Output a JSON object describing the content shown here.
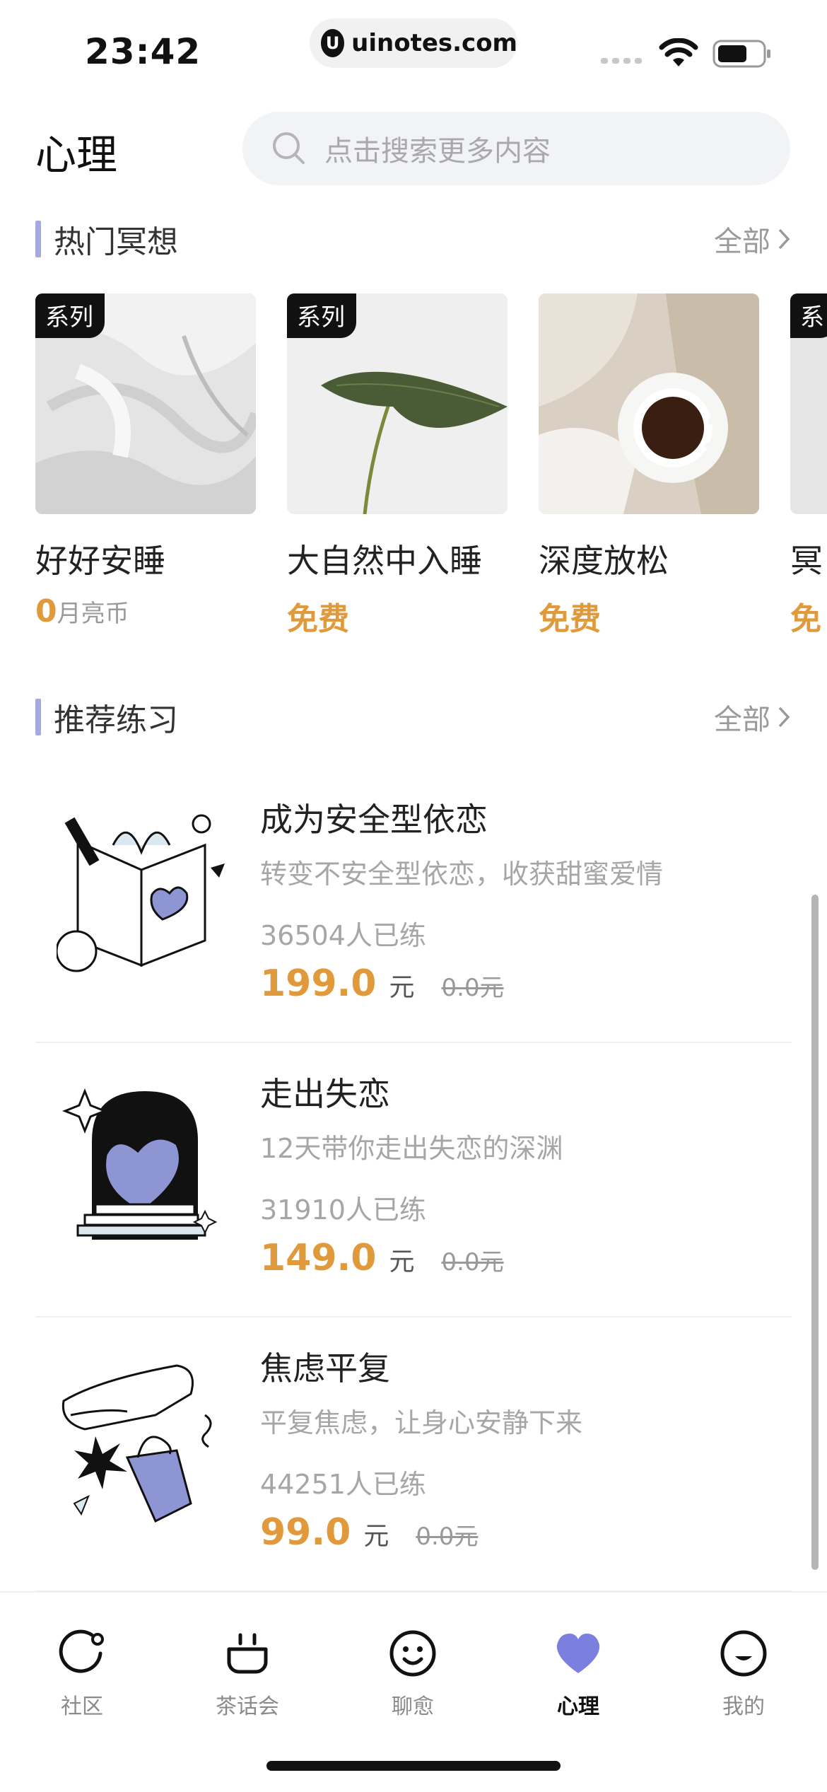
{
  "status_bar": {
    "time": "23:42",
    "url": "uinotes.com",
    "url_logo": "U"
  },
  "header": {
    "title": "心理",
    "search_placeholder": "点击搜索更多内容"
  },
  "meditation": {
    "title": "热门冥想",
    "more_label": "全部",
    "cards": [
      {
        "badge": "系列",
        "title": "好好安睡",
        "price": "0",
        "unit": "月亮币"
      },
      {
        "badge": "系列",
        "title": "大自然中入睡",
        "price": "免费"
      },
      {
        "title": "深度放松",
        "price": "免费"
      },
      {
        "badge": "系",
        "title": "冥",
        "price": "免"
      }
    ]
  },
  "practice": {
    "title": "推荐练习",
    "more_label": "全部",
    "items": [
      {
        "title": "成为安全型依恋",
        "desc": "转变不安全型依恋，收获甜蜜爱情",
        "count": "36504人已练",
        "price": "199.0",
        "unit": "元",
        "orig": "0.0元"
      },
      {
        "title": "走出失恋",
        "desc": "12天带你走出失恋的深渊",
        "count": "31910人已练",
        "price": "149.0",
        "unit": "元",
        "orig": "0.0元"
      },
      {
        "title": "焦虑平复",
        "desc": "平复焦虑，让身心安静下来",
        "count": "44251人已练",
        "price": "99.0",
        "unit": "元",
        "orig": "0.0元"
      }
    ]
  },
  "tabbar": {
    "items": [
      {
        "label": "社区",
        "icon": "community-icon"
      },
      {
        "label": "茶话会",
        "icon": "tea-party-icon"
      },
      {
        "label": "聊愈",
        "icon": "chat-heal-icon"
      },
      {
        "label": "心理",
        "icon": "heart-icon"
      },
      {
        "label": "我的",
        "icon": "profile-icon"
      }
    ],
    "active_index": 3
  },
  "colors": {
    "accent": "#7b7fde",
    "price": "#e09a3b",
    "section_bar": "#a6a9e0"
  }
}
